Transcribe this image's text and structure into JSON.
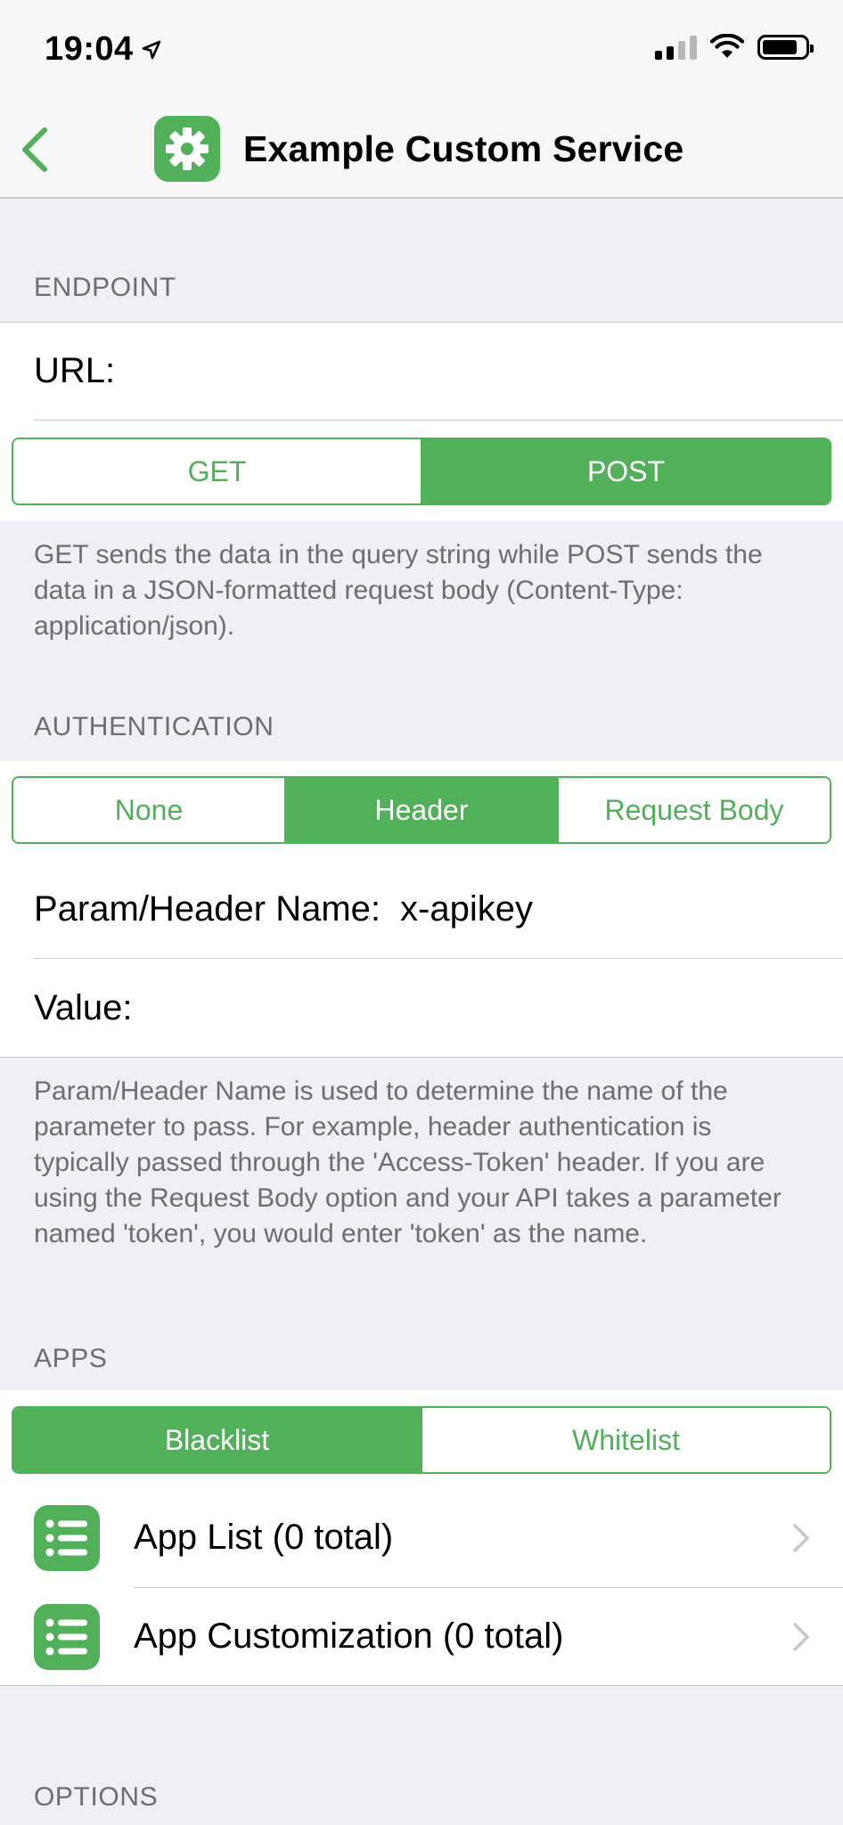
{
  "status_bar": {
    "time": "19:04"
  },
  "nav": {
    "title": "Example Custom Service"
  },
  "endpoint": {
    "header": "ENDPOINT",
    "url_label": "URL:",
    "url_value": "",
    "methods": [
      "GET",
      "POST"
    ],
    "selected_method": "POST",
    "footer": "GET sends the data in the query string while POST sends the data in a JSON-formatted request body (Content-Type: application/json)."
  },
  "authentication": {
    "header": "AUTHENTICATION",
    "options": [
      "None",
      "Header",
      "Request Body"
    ],
    "selected": "Header",
    "param_label": "Param/Header Name:",
    "param_value": "x-apikey",
    "value_label": "Value:",
    "value_value": "",
    "footer": "Param/Header Name is used to determine the name of the parameter to pass. For example, header authentication is typically passed through the 'Access-Token' header. If you are using the Request Body option and your API takes a parameter named 'token', you would enter 'token' as the name."
  },
  "apps": {
    "header": "APPS",
    "modes": [
      "Blacklist",
      "Whitelist"
    ],
    "selected_mode": "Blacklist",
    "items": [
      {
        "label": "App List (0 total)",
        "icon": "list-icon"
      },
      {
        "label": "App Customization (0 total)",
        "icon": "list-icon"
      }
    ]
  },
  "options": {
    "header": "OPTIONS"
  },
  "colors": {
    "accent": "#52b05a",
    "background": "#efeff4",
    "secondary_text": "#6d6d72"
  }
}
